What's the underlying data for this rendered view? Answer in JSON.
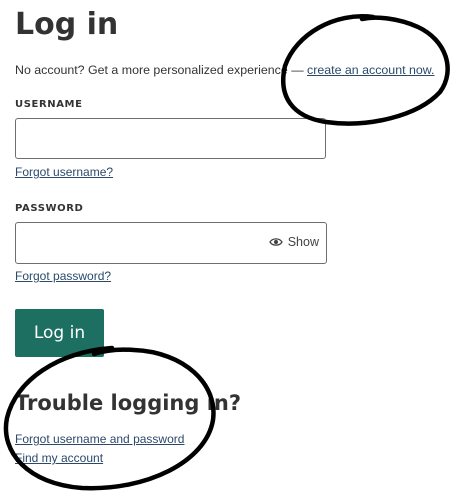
{
  "page": {
    "title": "Log in"
  },
  "intro": {
    "text": "No account? Get a more personalized experience — ",
    "create_account_link": "create an account now."
  },
  "username": {
    "label": "USERNAME",
    "value": "",
    "forgot_link": "Forgot username?"
  },
  "password": {
    "label": "PASSWORD",
    "value": "",
    "show_label": "Show",
    "forgot_link": "Forgot password?"
  },
  "login_button": {
    "label": "Log in",
    "color": "#1d6f61"
  },
  "trouble": {
    "heading": "Trouble logging in?",
    "forgot_both_link": "Forgot username and password",
    "find_account_link": "Find my account"
  },
  "icons": {
    "show_password": "eye-icon"
  },
  "colors": {
    "link": "#2b4a6b",
    "annotation_ink": "#000000"
  }
}
